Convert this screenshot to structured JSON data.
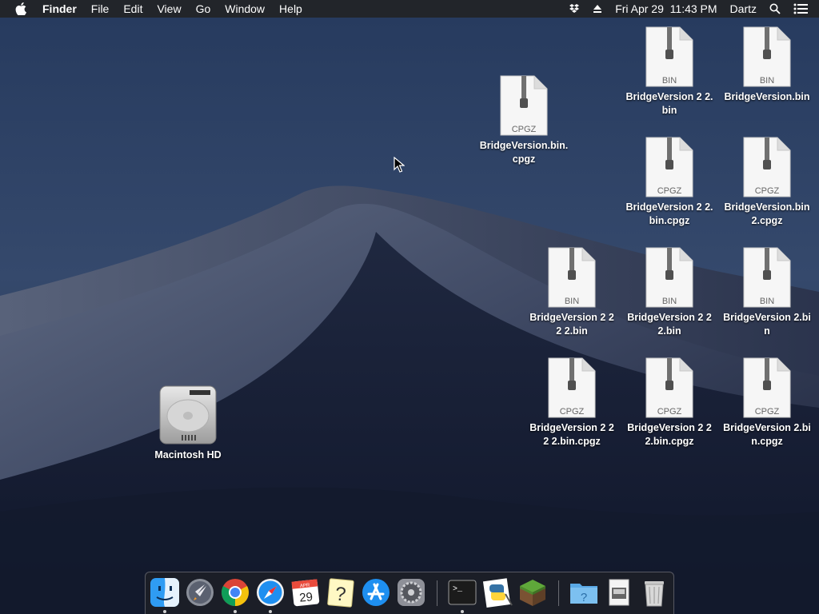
{
  "menubar": {
    "app_name": "Finder",
    "menus": [
      "File",
      "Edit",
      "View",
      "Go",
      "Window",
      "Help"
    ],
    "clock": "Fri Apr 29  11:43 PM",
    "user": "Dartz",
    "icons": [
      "apple-icon",
      "dropbox-icon",
      "eject-icon",
      "spotlight-icon",
      "notification-center-icon"
    ]
  },
  "desktop": {
    "drive": {
      "label": "Macintosh HD"
    },
    "files": [
      {
        "name": "BridgeVersion.bin.cpgz",
        "type": "CPGZ"
      },
      {
        "name": "BridgeVersion 2 2.bin",
        "type": "BIN"
      },
      {
        "name": "BridgeVersion.bin",
        "type": "BIN"
      },
      {
        "name": "BridgeVersion 2 2.bin.cpgz",
        "type": "CPGZ"
      },
      {
        "name": "BridgeVersion.bin 2.cpgz",
        "type": "CPGZ"
      },
      {
        "name": "BridgeVersion 2 2 2 2.bin",
        "type": "BIN"
      },
      {
        "name": "BridgeVersion 2 2 2.bin",
        "type": "BIN"
      },
      {
        "name": "BridgeVersion 2.bin",
        "type": "BIN"
      },
      {
        "name": "BridgeVersion 2 2 2 2.bin.cpgz",
        "type": "CPGZ"
      },
      {
        "name": "BridgeVersion 2 2 2.bin.cpgz",
        "type": "CPGZ"
      },
      {
        "name": "BridgeVersion 2.bin.cpgz",
        "type": "CPGZ"
      }
    ]
  },
  "dock": {
    "apps": [
      "Finder",
      "Launchpad",
      "Google Chrome",
      "Safari",
      "Calendar",
      "Help",
      "App Store",
      "System Preferences",
      "Terminal",
      "Python Launcher",
      "Minecraft",
      "Folder",
      "Document",
      "Trash"
    ],
    "calendar_day": "29",
    "calendar_month": "APR",
    "terminal_prompt": ">_"
  },
  "colors": {
    "menubar": "#222428",
    "accent": "#1e8ff0"
  }
}
